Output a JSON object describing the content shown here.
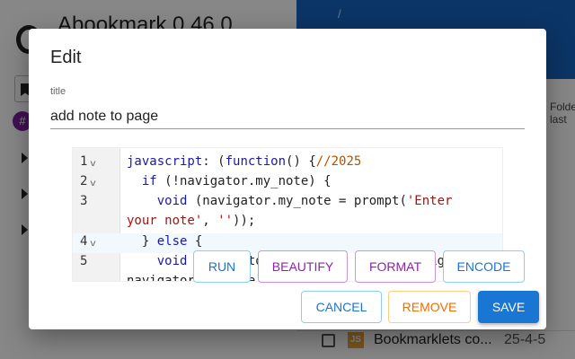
{
  "background": {
    "app_title": "Abookmark 0.46.0",
    "chip": "#",
    "breadcrumb_sep": "/",
    "folder_label_line1": "Folde",
    "folder_label_line2": "last",
    "row": {
      "icon_label": "JS",
      "label": "Bookmarklets co...",
      "date": "25-4-5"
    }
  },
  "dialog": {
    "title": "Edit",
    "field_label": "title",
    "field_value": "add note to page",
    "editor": {
      "line_numbers": [
        "1",
        "2",
        "3",
        "4",
        "5"
      ],
      "fold_marker": "v"
    },
    "editor_buttons": {
      "run": "RUN",
      "beautify": "BEAUTIFY",
      "format": "FORMAT",
      "encode": "ENCODE"
    },
    "actions": {
      "cancel": "CANCEL",
      "remove": "REMOVE",
      "save": "SAVE"
    }
  },
  "colors": {
    "primary": "#1976d2",
    "purple": "#8e24aa",
    "orange": "#ef6c00",
    "header_blue": "#1565c0"
  }
}
